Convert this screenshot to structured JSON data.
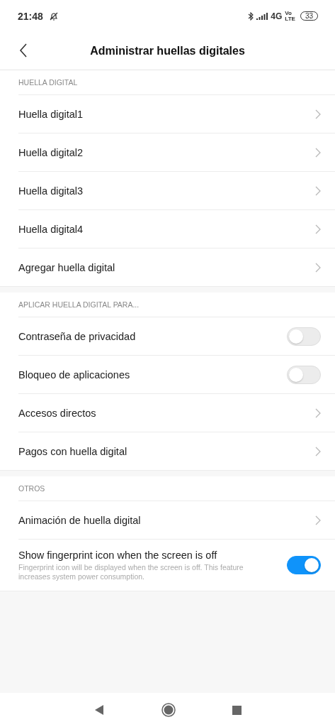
{
  "status_bar": {
    "time": "21:48",
    "network": "4G",
    "volte_top": "Vo",
    "volte_bottom": "LTE",
    "battery": "33"
  },
  "header": {
    "title": "Administrar huellas digitales"
  },
  "sections": [
    {
      "title": "HUELLA DIGITAL",
      "items": [
        {
          "kind": "link",
          "label": "Huella digital1"
        },
        {
          "kind": "link",
          "label": "Huella digital2"
        },
        {
          "kind": "link",
          "label": "Huella digital3"
        },
        {
          "kind": "link",
          "label": "Huella digital4"
        },
        {
          "kind": "link",
          "label": "Agregar huella digital"
        }
      ]
    },
    {
      "title": "APLICAR HUELLA DIGITAL PARA...",
      "items": [
        {
          "kind": "toggle",
          "label": "Contraseña de privacidad",
          "on": false
        },
        {
          "kind": "toggle",
          "label": "Bloqueo de aplicaciones",
          "on": false
        },
        {
          "kind": "link",
          "label": "Accesos directos"
        },
        {
          "kind": "link",
          "label": "Pagos con huella digital"
        }
      ]
    },
    {
      "title": "OTROS",
      "items": [
        {
          "kind": "link",
          "label": "Animación de huella digital"
        },
        {
          "kind": "toggle",
          "label": "Show fingerprint icon when the screen is off",
          "subtitle": "Fingerprint icon will be displayed when the screen is off. This feature increases system power consumption.",
          "on": true
        }
      ]
    }
  ]
}
